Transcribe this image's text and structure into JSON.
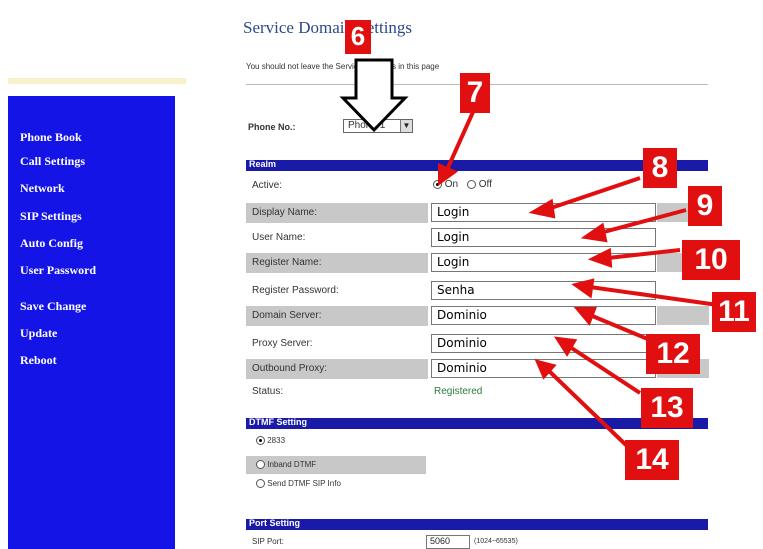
{
  "page": {
    "title": "Service Domain Settings",
    "note": "You should not leave the Service Domains in this page"
  },
  "sidebar": {
    "items": [
      {
        "label": "Phone Book"
      },
      {
        "label": "Call Settings"
      },
      {
        "label": "Network"
      },
      {
        "label": "SIP Settings"
      },
      {
        "label": "Auto Config"
      },
      {
        "label": "User Password"
      },
      {
        "label": "Save Change"
      },
      {
        "label": "Update"
      },
      {
        "label": "Reboot"
      }
    ]
  },
  "phone": {
    "label": "Phone No.:",
    "selected": "Phone 1"
  },
  "realm": {
    "header": "Realm",
    "active_label": "Active:",
    "on_label": "On",
    "off_label": "Off",
    "active_value": "On",
    "fields": [
      {
        "label": "Display Name:",
        "value": "Login"
      },
      {
        "label": "User Name:",
        "value": "Login"
      },
      {
        "label": "Register Name:",
        "value": "Login"
      },
      {
        "label": "Register Password:",
        "value": "Senha"
      },
      {
        "label": "Domain Server:",
        "value": "Dominio"
      },
      {
        "label": "Proxy Server:",
        "value": "Dominio"
      },
      {
        "label": "Outbound Proxy:",
        "value": "Dominio"
      }
    ],
    "status_label": "Status:",
    "status_value": "Registered"
  },
  "dtmf": {
    "header": "DTMF Setting",
    "options": [
      "2833",
      "Inband DTMF",
      "Send DTMF SIP Info"
    ],
    "selected": "2833"
  },
  "port": {
    "header": "Port Setting",
    "sip_label": "SIP Port:",
    "sip_value": "5060",
    "sip_range": "(1024~65535)"
  },
  "annotations": {
    "badges": [
      "6",
      "7",
      "8",
      "9",
      "10",
      "11",
      "12",
      "13",
      "14"
    ],
    "badge_color": "#e10f0f"
  },
  "colors": {
    "sidebar": "#1414e6",
    "section_bar": "#1a1aa8",
    "row_shade": "#c8c8c8",
    "title": "#2a4a8a"
  }
}
